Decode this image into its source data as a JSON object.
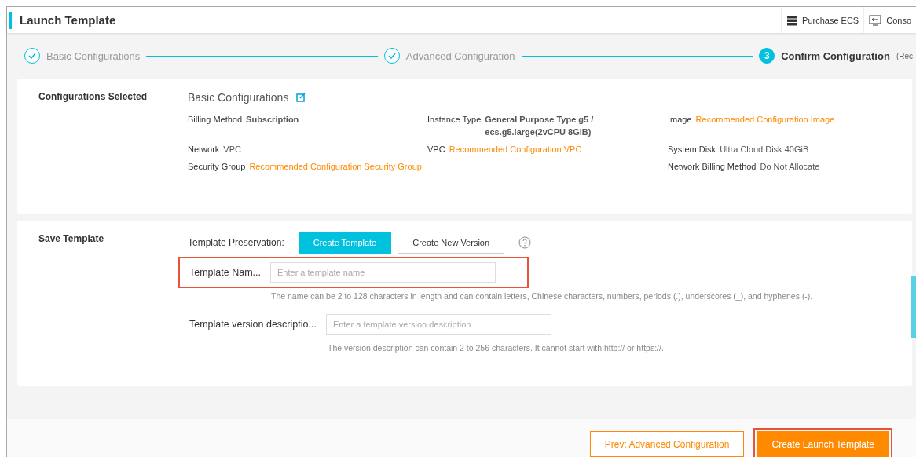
{
  "header": {
    "title": "Launch Template",
    "actions": [
      {
        "kind": "server",
        "label": "Purchase ECS"
      },
      {
        "kind": "console",
        "label": "Conso"
      }
    ]
  },
  "steps": [
    {
      "label": "Basic Configurations",
      "completed": true
    },
    {
      "label": "Advanced Configuration",
      "completed": true
    },
    {
      "number": "3",
      "label": "Confirm Configuration",
      "note": "(Rec",
      "completed": false
    }
  ],
  "summary": {
    "title": "Configurations Selected",
    "group_title": "Basic Configurations",
    "columns": [
      [
        {
          "label": "Billing Method",
          "value": "Subscription",
          "kind": "bold"
        },
        {
          "label": "Network",
          "value": "VPC",
          "kind": "plain"
        },
        {
          "label": "Security Group",
          "value": "Recommended Configuration Security Group",
          "kind": "link"
        }
      ],
      [
        {
          "label": "Instance Type",
          "value": "General Purpose Type g5 / ecs.g5.large(2vCPU 8GiB)",
          "kind": "bold"
        },
        {
          "label": "VPC",
          "value": "Recommended Configuration VPC",
          "kind": "link"
        }
      ],
      [
        {
          "label": "Image",
          "value": "Recommended Configuration Image",
          "kind": "link"
        },
        {
          "label": "System Disk",
          "value": "Ultra Cloud Disk 40GiB",
          "kind": "plain"
        },
        {
          "label": "Network Billing Method",
          "value": "Do Not Allocate",
          "kind": "plain"
        }
      ]
    ]
  },
  "save": {
    "title": "Save Template",
    "preservation_label": "Template Preservation:",
    "options": [
      {
        "label": "Create Template",
        "selected": true
      },
      {
        "label": "Create New Version",
        "selected": false
      }
    ],
    "fields": [
      {
        "label": "Template Nam...",
        "placeholder": "Enter a template name",
        "hint": "The name can be 2 to 128 characters in length and can contain letters, Chinese characters, numbers, periods (.), underscores (_), and hyphenes (-).",
        "highlighted": true
      },
      {
        "label": "Template version descriptio...",
        "placeholder": "Enter a template version description",
        "hint": "The version description can contain 2 to 256 characters. It cannot start with http:// or https://.",
        "highlighted": false
      }
    ]
  },
  "footer": {
    "buttons": [
      {
        "label": "Prev: Advanced Configuration",
        "kind": "secondary",
        "highlighted": false
      },
      {
        "label": "Create Launch Template",
        "kind": "primary",
        "highlighted": true
      }
    ]
  }
}
